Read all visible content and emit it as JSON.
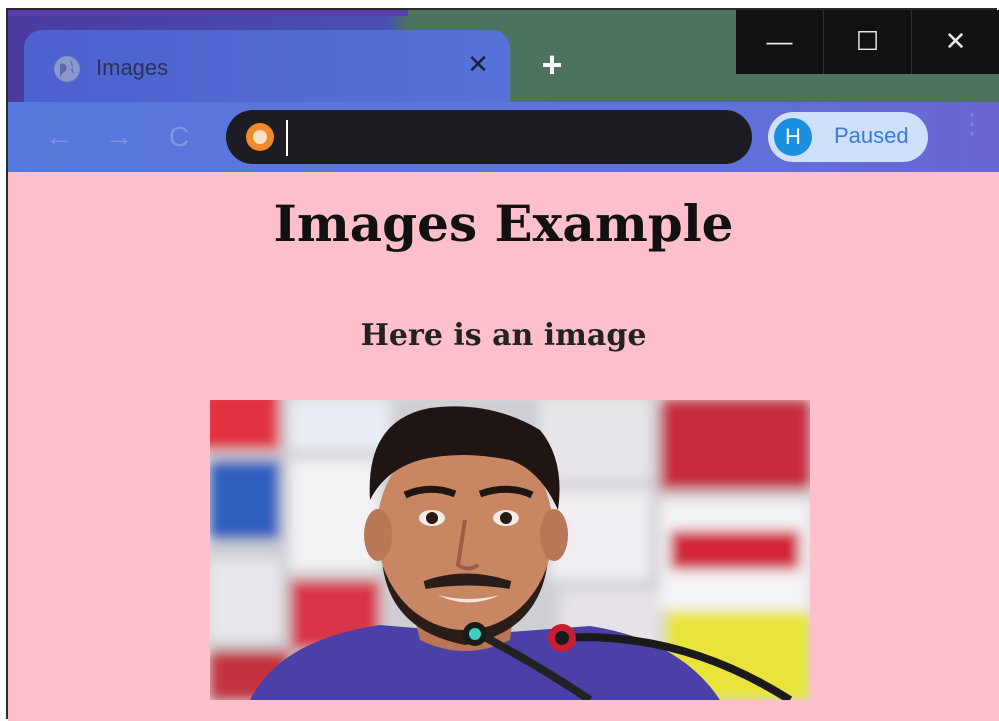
{
  "browser": {
    "tab": {
      "title": "Images",
      "close_icon": "close-icon",
      "favicon": "globe-icon"
    },
    "new_tab_label": "+",
    "window_controls": {
      "minimize": "—",
      "maximize": "☐",
      "close": "✕"
    },
    "toolbar": {
      "back": "←",
      "forward": "→",
      "reload": "C",
      "address_value": "",
      "profile_initial": "H",
      "profile_status": "Paused",
      "menu": "⋮"
    }
  },
  "page": {
    "heading": "Images Example",
    "subheading": "Here is an image",
    "image": {
      "icon": "photo-of-man-at-press-conference"
    }
  },
  "colors": {
    "page_background": "#ffc0cb",
    "tab_active": "#5473d8",
    "toolbar": "#5778dc",
    "omnibox": "#1c1c22",
    "window_controls": "#111111"
  }
}
